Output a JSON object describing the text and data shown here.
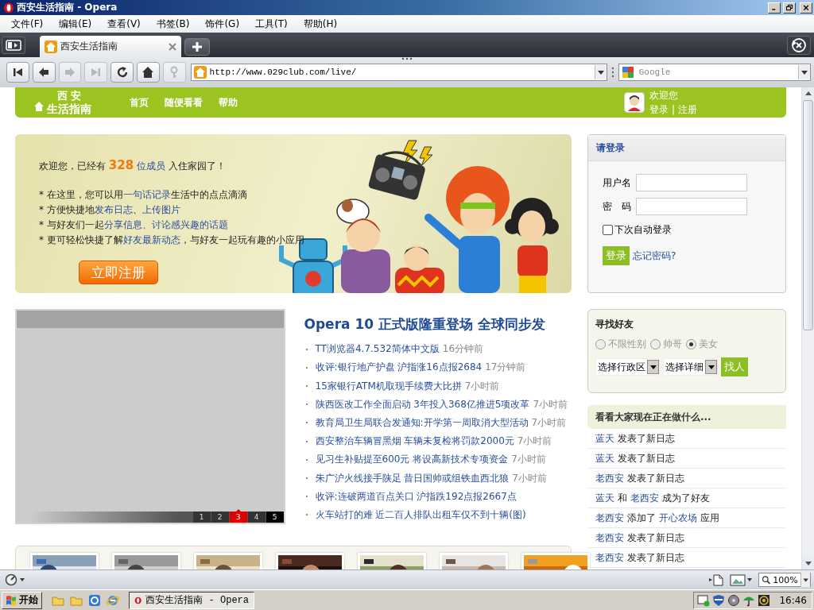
{
  "window": {
    "title": "西安生活指南 - Opera"
  },
  "menu": [
    "文件(F)",
    "编辑(E)",
    "查看(V)",
    "书签(B)",
    "饰件(G)",
    "工具(T)",
    "帮助(H)"
  ],
  "tabs": [
    {
      "label": "西安生活指南",
      "selected": true
    }
  ],
  "nav_buttons": [
    {
      "kind": "first",
      "disabled": false
    },
    {
      "kind": "back",
      "disabled": false
    },
    {
      "kind": "forward",
      "disabled": true
    },
    {
      "kind": "last",
      "disabled": true
    },
    {
      "kind": "reload",
      "disabled": false
    },
    {
      "kind": "home",
      "disabled": false
    },
    {
      "kind": "key",
      "disabled": true
    }
  ],
  "address_bar": {
    "url": "http://www.029club.com/live/"
  },
  "search": {
    "placeholder": "Google"
  },
  "page": {
    "header": {
      "logo_top": "西 安",
      "logo_bottom": "生活指南",
      "nav": [
        "首页",
        "随便看看",
        "帮助"
      ],
      "welcome": "欢迎您",
      "login_link": "登录",
      "separator": "|",
      "register_link": "注册"
    },
    "banner": {
      "intro": [
        {
          "kind": "plain",
          "text": "欢迎您，已经有 "
        },
        {
          "kind": "count",
          "text": "328"
        },
        {
          "kind": "link",
          "text": " 位成员"
        },
        {
          "kind": "plain",
          "text": " 入住家园了！"
        }
      ],
      "bullets": [
        [
          {
            "kind": "plain",
            "text": "* 在这里，您可以用"
          },
          {
            "kind": "link",
            "text": "一句话记录"
          },
          {
            "kind": "plain",
            "text": "生活中的点点滴滴"
          }
        ],
        [
          {
            "kind": "plain",
            "text": "* 方便快捷地"
          },
          {
            "kind": "link",
            "text": "发布日志"
          },
          {
            "kind": "plain",
            "text": "、"
          },
          {
            "kind": "link",
            "text": "上传图片"
          }
        ],
        [
          {
            "kind": "plain",
            "text": "* 与好友们一起"
          },
          {
            "kind": "link",
            "text": "分享信息、讨论感兴趣的话题"
          }
        ],
        [
          {
            "kind": "plain",
            "text": "* 更可轻松快捷了解"
          },
          {
            "kind": "link",
            "text": "好友最新动态"
          },
          {
            "kind": "plain",
            "text": "，与好友一起玩有趣的小应用"
          }
        ]
      ],
      "button": "立即注册"
    },
    "login": {
      "title": "请登录",
      "username_label": "用户名",
      "password_label": "密　码",
      "remember": {
        "label": "下次自动登录",
        "checked": false
      },
      "button": "登录",
      "forgot": "忘记密码?"
    },
    "slideshow": {
      "pages": [
        {
          "label": "1",
          "selected": false
        },
        {
          "label": "2",
          "selected": false
        },
        {
          "label": "3",
          "selected": true
        },
        {
          "label": "4",
          "selected": false
        },
        {
          "label": "5",
          "selected": false
        }
      ]
    },
    "news": {
      "headline": "Opera 10 正式版隆重登场 全球同步发",
      "items": [
        {
          "title": "TT浏览器4.7.532简体中文版",
          "time": "16分钟前"
        },
        {
          "title": "收评:银行地产护盘 沪指涨16点报2684",
          "time": "17分钟前"
        },
        {
          "title": "15家银行ATM机取现手续费大比拼",
          "time": "7小时前"
        },
        {
          "title": "陕西医改工作全面启动 3年投入368亿推进5项改革",
          "time": "7小时前"
        },
        {
          "title": "教育局卫生局联合发通知:开学第一周取消大型活动",
          "time": "7小时前"
        },
        {
          "title": "西安整治车辆冒黑烟 车辆未复检将罚款2000元",
          "time": "7小时前"
        },
        {
          "title": "见习生补贴提至600元 将设高新技术专项资金",
          "time": "7小时前"
        },
        {
          "title": "朱广沪火线接手陕足 昔日国帅或组铁血西北狼",
          "time": "7小时前"
        },
        {
          "title": "收评:连破两道百点关口 沪指跌192点报2667点"
        },
        {
          "title": "火车站打的难 近二百人排队出租车仅不到十辆(图)"
        }
      ]
    },
    "find_friends": {
      "title": "寻找好友",
      "genders": [
        {
          "label": "不限性别",
          "selected": false
        },
        {
          "label": "帅哥",
          "selected": false
        },
        {
          "label": "美女",
          "selected": true
        }
      ],
      "region": "选择行政区",
      "detail": "选择详细",
      "button": "找人"
    },
    "activity": {
      "title": "看看大家现在正在做什么...",
      "items": [
        [
          {
            "kind": "user",
            "text": "蓝天"
          },
          {
            "kind": "text",
            "text": "发表了新日志"
          }
        ],
        [
          {
            "kind": "user",
            "text": "蓝天"
          },
          {
            "kind": "text",
            "text": "发表了新日志"
          }
        ],
        [
          {
            "kind": "user",
            "text": "老西安"
          },
          {
            "kind": "text",
            "text": "发表了新日志"
          }
        ],
        [
          {
            "kind": "user",
            "text": "蓝天"
          },
          {
            "kind": "text",
            "text": "和"
          },
          {
            "kind": "user",
            "text": "老西安"
          },
          {
            "kind": "text",
            "text": "成为了好友"
          }
        ],
        [
          {
            "kind": "user",
            "text": "老西安"
          },
          {
            "kind": "text",
            "text": "添加了"
          },
          {
            "kind": "app",
            "text": "开心农场"
          },
          {
            "kind": "text",
            "text": "应用"
          }
        ],
        [
          {
            "kind": "user",
            "text": "老西安"
          },
          {
            "kind": "text",
            "text": "发表了新日志"
          }
        ],
        [
          {
            "kind": "user",
            "text": "老西安"
          },
          {
            "kind": "text",
            "text": "发表了新日志"
          }
        ]
      ]
    }
  },
  "status_bar": {
    "zoom": "100%"
  },
  "taskbar": {
    "start": "开始",
    "tasks": [
      {
        "label": "西安生活指南 - Opera",
        "selected": true
      }
    ],
    "clock": "16:46"
  }
}
